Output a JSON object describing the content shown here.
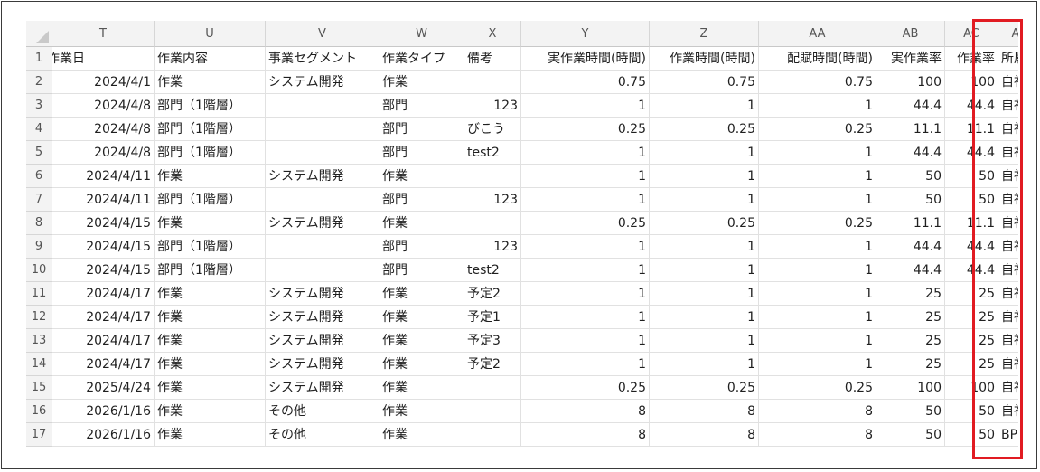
{
  "colors": {
    "header_bg": "#f3f3f3",
    "gridline": "#e1e1e1",
    "highlight": "#e11b22"
  },
  "sheet": {
    "corner_icon": "select-all-triangle-icon",
    "columns": [
      "T",
      "U",
      "V",
      "W",
      "X",
      "Y",
      "Z",
      "AA",
      "AB",
      "AC",
      "AD"
    ],
    "header_row": [
      "作業日",
      "作業内容",
      "事業セグメント",
      "作業タイプ",
      "備考",
      "実作業時間(時間)",
      "作業時間(時間)",
      "配賦時間(時間)",
      "実作業率",
      "作業率",
      "所属"
    ],
    "rows": [
      {
        "num": "2",
        "cells": [
          "2024/4/1",
          "作業",
          "システム開発",
          "作業",
          "",
          "0.75",
          "0.75",
          "0.75",
          "100",
          "100",
          "自社"
        ]
      },
      {
        "num": "3",
        "cells": [
          "2024/4/8",
          "部門（1階層）",
          "",
          "部門",
          "123",
          "1",
          "1",
          "1",
          "44.4",
          "44.4",
          "自社"
        ]
      },
      {
        "num": "4",
        "cells": [
          "2024/4/8",
          "部門（1階層）",
          "",
          "部門",
          "びこう",
          "0.25",
          "0.25",
          "0.25",
          "11.1",
          "11.1",
          "自社"
        ]
      },
      {
        "num": "5",
        "cells": [
          "2024/4/8",
          "部門（1階層）",
          "",
          "部門",
          "test2",
          "1",
          "1",
          "1",
          "44.4",
          "44.4",
          "自社"
        ]
      },
      {
        "num": "6",
        "cells": [
          "2024/4/11",
          "作業",
          "システム開発",
          "作業",
          "",
          "1",
          "1",
          "1",
          "50",
          "50",
          "自社"
        ]
      },
      {
        "num": "7",
        "cells": [
          "2024/4/11",
          "部門（1階層）",
          "",
          "部門",
          "123",
          "1",
          "1",
          "1",
          "50",
          "50",
          "自社"
        ]
      },
      {
        "num": "8",
        "cells": [
          "2024/4/15",
          "作業",
          "システム開発",
          "作業",
          "",
          "0.25",
          "0.25",
          "0.25",
          "11.1",
          "11.1",
          "自社"
        ]
      },
      {
        "num": "9",
        "cells": [
          "2024/4/15",
          "部門（1階層）",
          "",
          "部門",
          "123",
          "1",
          "1",
          "1",
          "44.4",
          "44.4",
          "自社"
        ]
      },
      {
        "num": "10",
        "cells": [
          "2024/4/15",
          "部門（1階層）",
          "",
          "部門",
          "test2",
          "1",
          "1",
          "1",
          "44.4",
          "44.4",
          "自社"
        ]
      },
      {
        "num": "11",
        "cells": [
          "2024/4/17",
          "作業",
          "システム開発",
          "作業",
          "予定2",
          "1",
          "1",
          "1",
          "25",
          "25",
          "自社"
        ]
      },
      {
        "num": "12",
        "cells": [
          "2024/4/17",
          "作業",
          "システム開発",
          "作業",
          "予定1",
          "1",
          "1",
          "1",
          "25",
          "25",
          "自社"
        ]
      },
      {
        "num": "13",
        "cells": [
          "2024/4/17",
          "作業",
          "システム開発",
          "作業",
          "予定3",
          "1",
          "1",
          "1",
          "25",
          "25",
          "自社"
        ]
      },
      {
        "num": "14",
        "cells": [
          "2024/4/17",
          "作業",
          "システム開発",
          "作業",
          "予定2",
          "1",
          "1",
          "1",
          "25",
          "25",
          "自社"
        ]
      },
      {
        "num": "15",
        "cells": [
          "2025/4/24",
          "作業",
          "システム開発",
          "作業",
          "",
          "0.25",
          "0.25",
          "0.25",
          "100",
          "100",
          "自社"
        ]
      },
      {
        "num": "16",
        "cells": [
          "2026/1/16",
          "作業",
          "その他",
          "作業",
          "",
          "8",
          "8",
          "8",
          "50",
          "50",
          "自社"
        ]
      },
      {
        "num": "17",
        "cells": [
          "2026/1/16",
          "作業",
          "その他",
          "作業",
          "",
          "8",
          "8",
          "8",
          "50",
          "50",
          "BP"
        ]
      }
    ]
  }
}
